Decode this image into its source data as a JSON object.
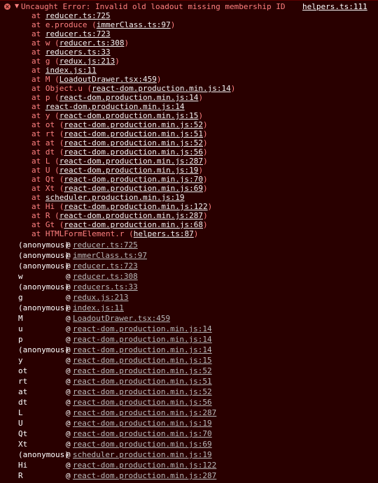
{
  "error": {
    "icon": "error-circle-icon",
    "expand_icon": "expand-triangle-icon",
    "message": "Uncaught Error: Invalid old loadout missing membership ID",
    "source": "helpers.ts:111"
  },
  "stack": [
    {
      "prefix": "at ",
      "name": "",
      "open": "",
      "link": "reducer.ts:725",
      "close": ""
    },
    {
      "prefix": "at ",
      "name": "e.produce",
      "open": " (",
      "link": "immerClass.ts:97",
      "close": ")"
    },
    {
      "prefix": "at ",
      "name": "",
      "open": "",
      "link": "reducer.ts:723",
      "close": ""
    },
    {
      "prefix": "at ",
      "name": "w",
      "open": " (",
      "link": "reducer.ts:308",
      "close": ")"
    },
    {
      "prefix": "at ",
      "name": "",
      "open": "",
      "link": "reducers.ts:33",
      "close": ""
    },
    {
      "prefix": "at ",
      "name": "g",
      "open": " (",
      "link": "redux.js:213",
      "close": ")"
    },
    {
      "prefix": "at ",
      "name": "",
      "open": "",
      "link": "index.js:11",
      "close": ""
    },
    {
      "prefix": "at ",
      "name": "M",
      "open": " (",
      "link": "LoadoutDrawer.tsx:459",
      "close": ")"
    },
    {
      "prefix": "at ",
      "name": "Object.u",
      "open": " (",
      "link": "react-dom.production.min.js:14",
      "close": ")"
    },
    {
      "prefix": "at ",
      "name": "p",
      "open": " (",
      "link": "react-dom.production.min.js:14",
      "close": ")"
    },
    {
      "prefix": "at ",
      "name": "",
      "open": "",
      "link": "react-dom.production.min.js:14",
      "close": ""
    },
    {
      "prefix": "at ",
      "name": "y",
      "open": " (",
      "link": "react-dom.production.min.js:15",
      "close": ")"
    },
    {
      "prefix": "at ",
      "name": "ot",
      "open": " (",
      "link": "react-dom.production.min.js:52",
      "close": ")"
    },
    {
      "prefix": "at ",
      "name": "rt",
      "open": " (",
      "link": "react-dom.production.min.js:51",
      "close": ")"
    },
    {
      "prefix": "at ",
      "name": "at",
      "open": " (",
      "link": "react-dom.production.min.js:52",
      "close": ")"
    },
    {
      "prefix": "at ",
      "name": "dt",
      "open": " (",
      "link": "react-dom.production.min.js:56",
      "close": ")"
    },
    {
      "prefix": "at ",
      "name": "L",
      "open": " (",
      "link": "react-dom.production.min.js:287",
      "close": ")"
    },
    {
      "prefix": "at ",
      "name": "U",
      "open": " (",
      "link": "react-dom.production.min.js:19",
      "close": ")"
    },
    {
      "prefix": "at ",
      "name": "Qt",
      "open": " (",
      "link": "react-dom.production.min.js:70",
      "close": ")"
    },
    {
      "prefix": "at ",
      "name": "Xt",
      "open": " (",
      "link": "react-dom.production.min.js:69",
      "close": ")"
    },
    {
      "prefix": "at ",
      "name": "",
      "open": "",
      "link": "scheduler.production.min.js:19",
      "close": ""
    },
    {
      "prefix": "at ",
      "name": "Hi",
      "open": " (",
      "link": "react-dom.production.min.js:122",
      "close": ")"
    },
    {
      "prefix": "at ",
      "name": "R",
      "open": " (",
      "link": "react-dom.production.min.js:287",
      "close": ")"
    },
    {
      "prefix": "at ",
      "name": "Gt",
      "open": " (",
      "link": "react-dom.production.min.js:68",
      "close": ")"
    },
    {
      "prefix": "at ",
      "name": "HTMLFormElement.r",
      "open": " (",
      "link": "helpers.ts:87",
      "close": ")"
    }
  ],
  "async_stack": [
    {
      "fn": "(anonymous)",
      "at": "@",
      "loc": "reducer.ts:725"
    },
    {
      "fn": "(anonymous)",
      "at": "@",
      "loc": "immerClass.ts:97"
    },
    {
      "fn": "(anonymous)",
      "at": "@",
      "loc": "reducer.ts:723"
    },
    {
      "fn": "w",
      "at": "@",
      "loc": "reducer.ts:308"
    },
    {
      "fn": "(anonymous)",
      "at": "@",
      "loc": "reducers.ts:33"
    },
    {
      "fn": "g",
      "at": "@",
      "loc": "redux.js:213"
    },
    {
      "fn": "(anonymous)",
      "at": "@",
      "loc": "index.js:11"
    },
    {
      "fn": "M",
      "at": "@",
      "loc": "LoadoutDrawer.tsx:459"
    },
    {
      "fn": "u",
      "at": "@",
      "loc": "react-dom.production.min.js:14"
    },
    {
      "fn": "p",
      "at": "@",
      "loc": "react-dom.production.min.js:14"
    },
    {
      "fn": "(anonymous)",
      "at": "@",
      "loc": "react-dom.production.min.js:14"
    },
    {
      "fn": "y",
      "at": "@",
      "loc": "react-dom.production.min.js:15"
    },
    {
      "fn": "ot",
      "at": "@",
      "loc": "react-dom.production.min.js:52"
    },
    {
      "fn": "rt",
      "at": "@",
      "loc": "react-dom.production.min.js:51"
    },
    {
      "fn": "at",
      "at": "@",
      "loc": "react-dom.production.min.js:52"
    },
    {
      "fn": "dt",
      "at": "@",
      "loc": "react-dom.production.min.js:56"
    },
    {
      "fn": "L",
      "at": "@",
      "loc": "react-dom.production.min.js:287"
    },
    {
      "fn": "U",
      "at": "@",
      "loc": "react-dom.production.min.js:19"
    },
    {
      "fn": "Qt",
      "at": "@",
      "loc": "react-dom.production.min.js:70"
    },
    {
      "fn": "Xt",
      "at": "@",
      "loc": "react-dom.production.min.js:69"
    },
    {
      "fn": "(anonymous)",
      "at": "@",
      "loc": "scheduler.production.min.js:19"
    },
    {
      "fn": "Hi",
      "at": "@",
      "loc": "react-dom.production.min.js:122"
    },
    {
      "fn": "R",
      "at": "@",
      "loc": "react-dom.production.min.js:287"
    }
  ],
  "colors": {
    "background": "#290000",
    "error_text": "#ff8080",
    "link": "#f2f2f2",
    "async_link": "#b8b8b8",
    "icon": "#e46962"
  }
}
